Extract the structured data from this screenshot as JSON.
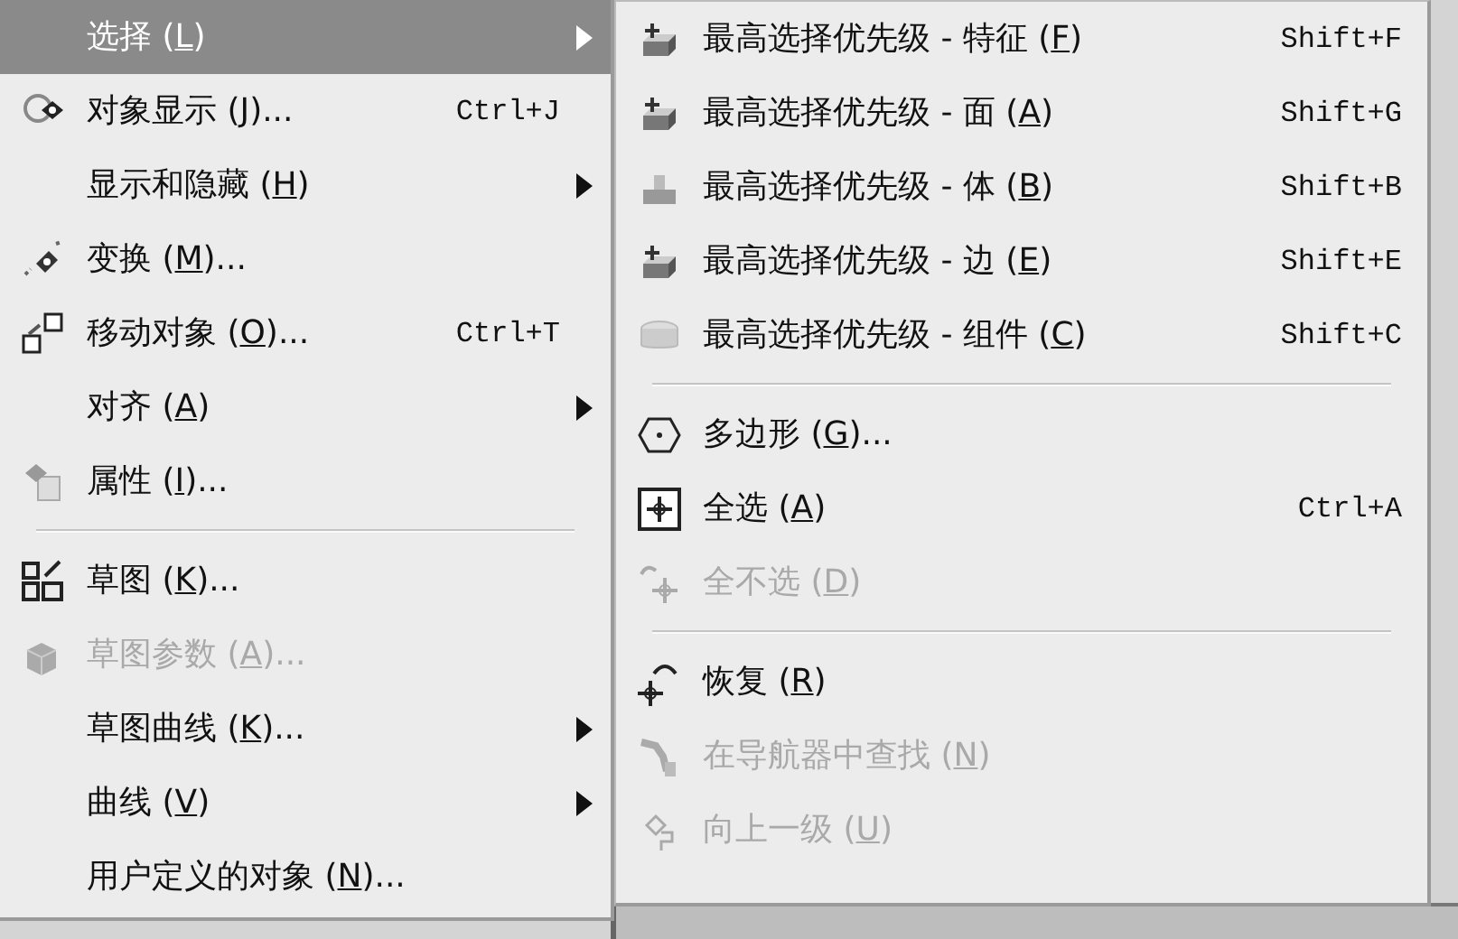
{
  "main_menu": {
    "items": [
      {
        "kind": "item",
        "pre": "选择 (",
        "mnemonic": "L",
        "post": ")",
        "submenu": true,
        "selected": true,
        "disabled": false
      },
      {
        "kind": "item",
        "pre": "对象显示 (",
        "mnemonic": "J",
        "post": ")...",
        "shortcut": "Ctrl+J",
        "submenu": false,
        "selected": false,
        "disabled": false
      },
      {
        "kind": "item",
        "pre": "显示和隐藏 (",
        "mnemonic": "H",
        "post": ")",
        "submenu": true,
        "selected": false,
        "disabled": false
      },
      {
        "kind": "item",
        "pre": "变换 (",
        "mnemonic": "M",
        "post": ")...",
        "submenu": false,
        "selected": false,
        "disabled": false
      },
      {
        "kind": "item",
        "pre": "移动对象 (",
        "mnemonic": "O",
        "post": ")...",
        "shortcut": "Ctrl+T",
        "submenu": false,
        "selected": false,
        "disabled": false
      },
      {
        "kind": "item",
        "pre": "对齐 (",
        "mnemonic": "A",
        "post": ")",
        "submenu": true,
        "selected": false,
        "disabled": false
      },
      {
        "kind": "item",
        "pre": "属性 (",
        "mnemonic": "I",
        "post": ")...",
        "submenu": false,
        "selected": false,
        "disabled": false
      },
      {
        "kind": "separator"
      },
      {
        "kind": "item",
        "pre": "草图 (",
        "mnemonic": "K",
        "post": ")...",
        "submenu": false,
        "selected": false,
        "disabled": false
      },
      {
        "kind": "item",
        "pre": "草图参数 (",
        "mnemonic": "A",
        "post": ")...",
        "submenu": false,
        "selected": false,
        "disabled": true
      },
      {
        "kind": "item",
        "pre": "草图曲线 (",
        "mnemonic": "K",
        "post": ")...",
        "submenu": true,
        "selected": false,
        "disabled": false
      },
      {
        "kind": "item",
        "pre": "曲线 (",
        "mnemonic": "V",
        "post": ")",
        "submenu": true,
        "selected": false,
        "disabled": false
      },
      {
        "kind": "item",
        "pre": "用户定义的对象 (",
        "mnemonic": "N",
        "post": ")...",
        "submenu": false,
        "selected": false,
        "disabled": false
      }
    ]
  },
  "submenu": {
    "items": [
      {
        "kind": "item",
        "pre": "最高选择优先级 - 特征 (",
        "mnemonic": "F",
        "post": ")",
        "shortcut": "Shift+F",
        "disabled": false
      },
      {
        "kind": "item",
        "pre": "最高选择优先级 - 面 (",
        "mnemonic": "A",
        "post": ")",
        "shortcut": "Shift+G",
        "disabled": false
      },
      {
        "kind": "item",
        "pre": "最高选择优先级 - 体 (",
        "mnemonic": "B",
        "post": ")",
        "shortcut": "Shift+B",
        "disabled": false
      },
      {
        "kind": "item",
        "pre": "最高选择优先级 - 边 (",
        "mnemonic": "E",
        "post": ")",
        "shortcut": "Shift+E",
        "disabled": false
      },
      {
        "kind": "item",
        "pre": "最高选择优先级 - 组件 (",
        "mnemonic": "C",
        "post": ")",
        "shortcut": "Shift+C",
        "disabled": false
      },
      {
        "kind": "separator"
      },
      {
        "kind": "item",
        "pre": "多边形 (",
        "mnemonic": "G",
        "post": ")...",
        "disabled": false
      },
      {
        "kind": "item",
        "pre": "全选 (",
        "mnemonic": "A",
        "post": ")",
        "shortcut": "Ctrl+A",
        "disabled": false
      },
      {
        "kind": "item",
        "pre": "全不选 (",
        "mnemonic": "D",
        "post": ")",
        "disabled": true
      },
      {
        "kind": "separator"
      },
      {
        "kind": "item",
        "pre": "恢复 (",
        "mnemonic": "R",
        "post": ")",
        "disabled": false
      },
      {
        "kind": "item",
        "pre": "在导航器中查找 (",
        "mnemonic": "N",
        "post": ")",
        "disabled": true
      },
      {
        "kind": "item",
        "pre": "向上一级 (",
        "mnemonic": "U",
        "post": ")",
        "disabled": true
      }
    ]
  }
}
